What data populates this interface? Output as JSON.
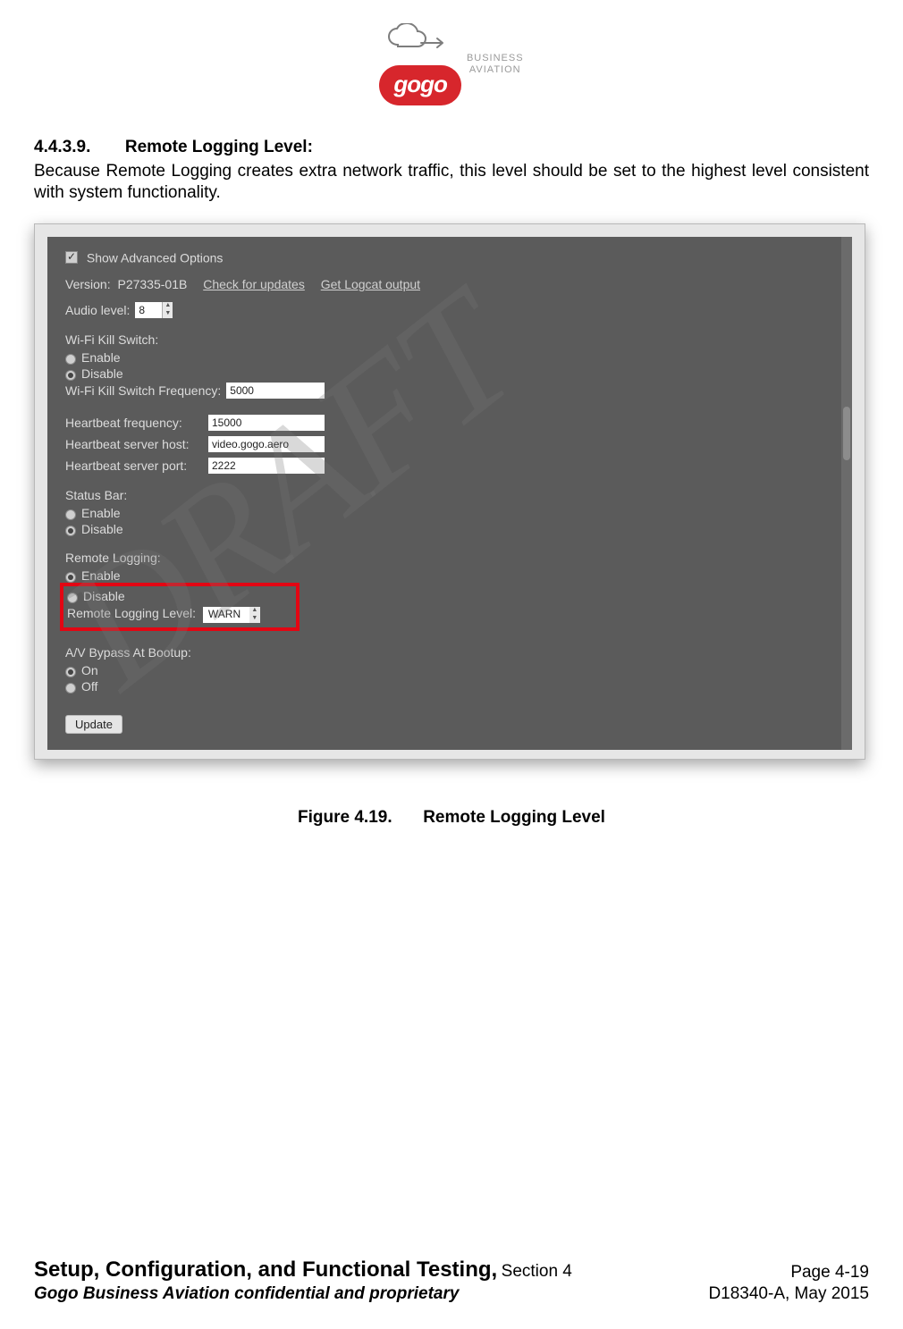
{
  "brand": {
    "name": "gogo",
    "sub1": "BUSINESS",
    "sub2": "AVIATION"
  },
  "section": {
    "number": "4.4.3.9.",
    "title": "Remote Logging Level:"
  },
  "paragraph": "Because Remote Logging creates extra network traffic, this level should be set to the highest level consistent with system functionality.",
  "panel": {
    "show_adv": "Show Advanced Options",
    "version_label": "Version:",
    "version_value": "P27335-01B",
    "check_updates": "Check for updates",
    "get_logcat": "Get Logcat output",
    "audio_level_label": "Audio level:",
    "audio_level_value": "8",
    "wifi_kill_title": "Wi-Fi Kill Switch:",
    "enable": "Enable",
    "disable": "Disable",
    "wifi_freq_label": "Wi-Fi Kill Switch Frequency:",
    "wifi_freq_value": "5000",
    "hb_freq_label": "Heartbeat frequency:",
    "hb_freq_value": "15000",
    "hb_host_label": "Heartbeat server host:",
    "hb_host_value": "video.gogo.aero",
    "hb_port_label": "Heartbeat server port:",
    "hb_port_value": "2222",
    "status_bar_title": "Status Bar:",
    "remote_logging_title": "Remote Logging:",
    "remote_logging_level_label": "Remote Logging Level:",
    "remote_logging_level_value": "WARN",
    "av_bypass_title": "A/V Bypass At Bootup:",
    "on": "On",
    "off": "Off",
    "update_btn": "Update"
  },
  "figure": {
    "num": "Figure 4.19.",
    "title": "Remote Logging Level"
  },
  "watermark": "DRAFT",
  "footer": {
    "title": "Setup, Configuration, and Functional Testing,",
    "section": "Section 4",
    "page": "Page 4-19",
    "conf": "Gogo Business Aviation confidential and proprietary",
    "docid": "D18340-A, May 2015"
  }
}
